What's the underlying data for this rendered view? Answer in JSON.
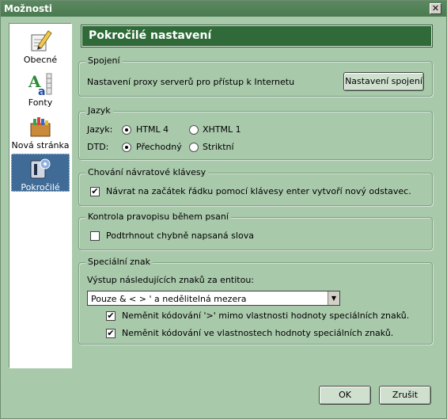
{
  "window": {
    "title": "Možnosti",
    "close_label": "✕"
  },
  "sidebar": {
    "items": [
      {
        "label": "Obecné"
      },
      {
        "label": "Fonty"
      },
      {
        "label": "Nová stránka"
      },
      {
        "label": "Pokročilé"
      }
    ]
  },
  "header": {
    "title": "Pokročilé nastavení"
  },
  "spojeni": {
    "legend": "Spojení",
    "text": "Nastavení proxy serverů pro přístup k Internetu",
    "button": "Nastavení spojení"
  },
  "jazyk": {
    "legend": "Jazyk",
    "jazyk_label": "Jazyk:",
    "html4": "HTML 4",
    "xhtml1": "XHTML 1",
    "dtd_label": "DTD:",
    "prechodny": "Přechodný",
    "striktni": "Striktní"
  },
  "enter": {
    "legend": "Chování návratové klávesy",
    "checkbox_label": "Návrat na začátek řádku pomocí klávesy enter vytvoří nový odstavec."
  },
  "pravopis": {
    "legend": "Kontrola pravopisu během psaní",
    "checkbox_label": "Podtrhnout chybně napsaná slova"
  },
  "specialni": {
    "legend": "Speciální znak",
    "output_label": "Výstup následujících znaků za entitou:",
    "select_value": "Pouze & < > ' a nedělitelná mezera",
    "check1": "Neměnit kódování '>' mimo vlastnosti hodnoty speciálních znaků.",
    "check2": "Neměnit kódování ve vlastnostech hodnoty speciálních znaků."
  },
  "footer": {
    "ok": "OK",
    "cancel": "Zrušit"
  },
  "checkmark": "✔",
  "dropdown_arrow": "▼"
}
